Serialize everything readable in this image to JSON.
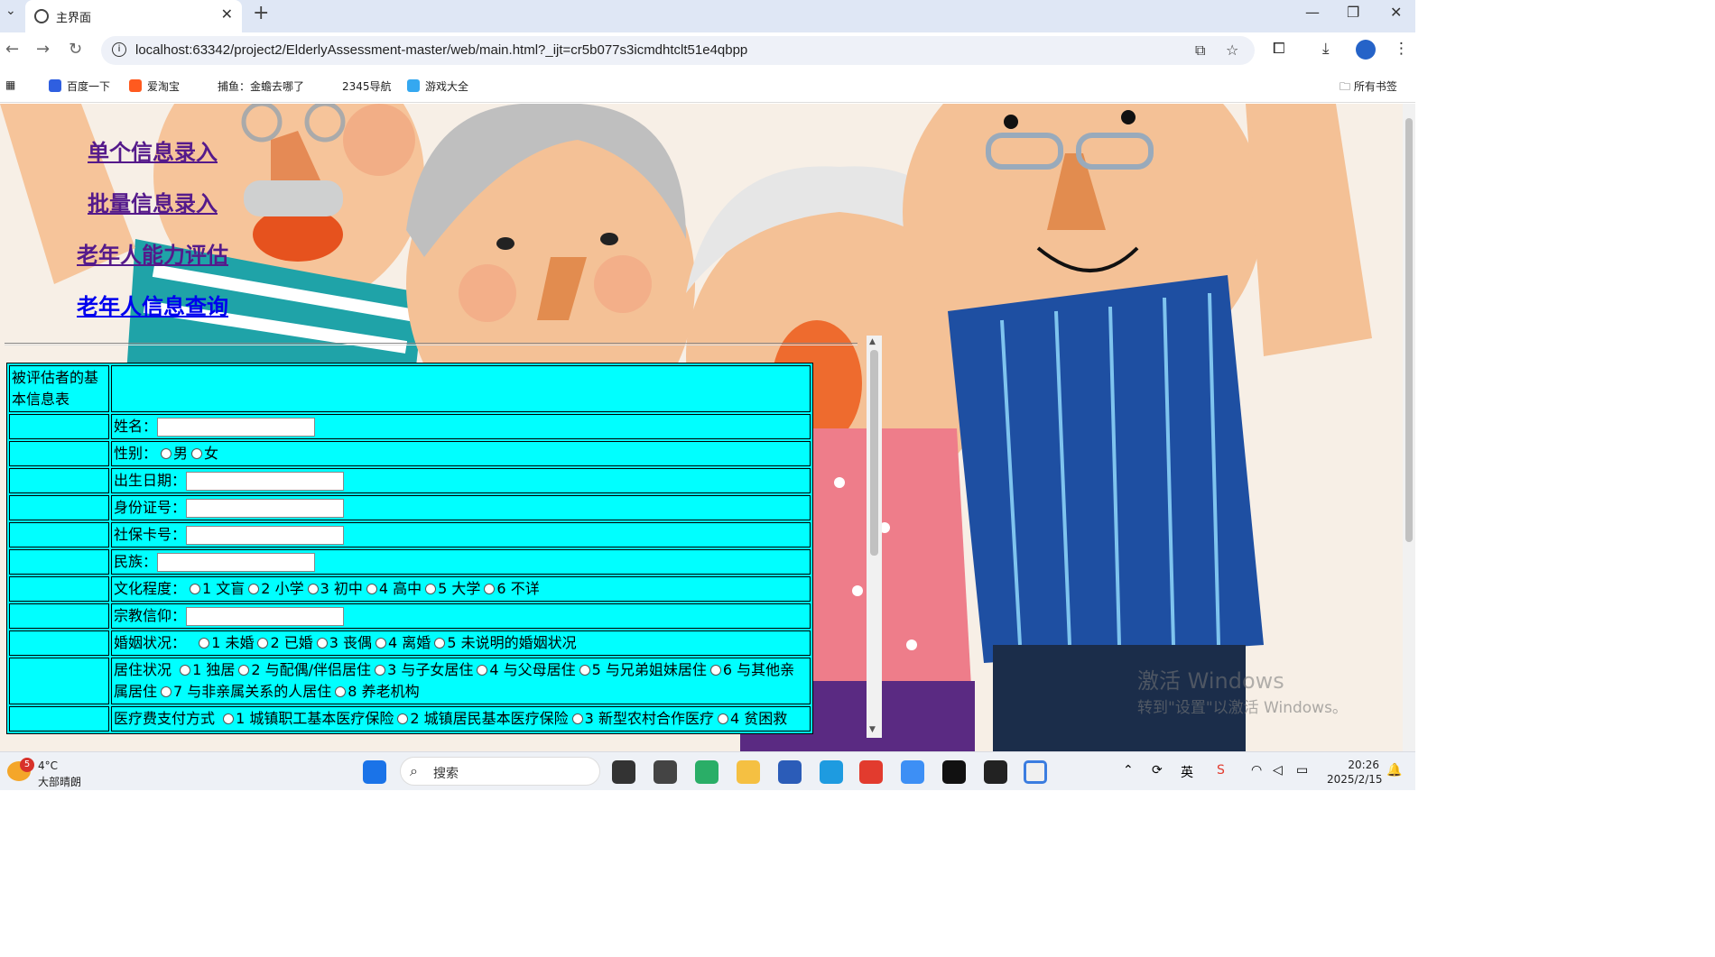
{
  "browser": {
    "tab_title": "主界面",
    "url": "localhost:63342/project2/ElderlyAssessment-master/web/main.html?_ijt=cr5b077s3icmdhtclt51e4qbpp",
    "bookmarks": [
      "百度一下",
      "爱淘宝",
      "捕鱼：金蟾去哪了",
      "2345导航",
      "游戏大全"
    ],
    "all_bookmarks": "所有书签"
  },
  "nav": {
    "single_entry": "单个信息录入",
    "batch_entry": "批量信息录入",
    "ability_assessment": "老年人能力评估",
    "info_query": "老年人信息查询"
  },
  "form": {
    "title": "被评估者的基本信息表",
    "name_label": "姓名：",
    "gender_label": "性别：",
    "gender_options": [
      "男",
      "女"
    ],
    "birth_label": "出生日期：",
    "id_label": "身份证号：",
    "social_label": "社保卡号：",
    "ethnic_label": "民族：",
    "education_label": "文化程度：",
    "education_options": [
      "1 文盲",
      "2 小学",
      "3 初中",
      "4 高中",
      "5 大学",
      "6 不详"
    ],
    "religion_label": "宗教信仰：",
    "marital_label": "婚姻状况：",
    "marital_options": [
      "1 未婚",
      "2 已婚",
      "3 丧偶",
      "4 离婚",
      "5 未说明的婚姻状况"
    ],
    "living_label": "居住状况",
    "living_options": [
      "1 独居",
      "2 与配偶/伴侣居住",
      "3 与子女居住",
      "4 与父母居住",
      "5 与兄弟姐妹居住",
      "6 与其他亲属居住",
      "7 与非亲属关系的人居住",
      "8 养老机构"
    ],
    "payment_label": "医疗费支付方式",
    "payment_options": [
      "1 城镇职工基本医疗保险",
      "2 城镇居民基本医疗保险",
      "3 新型农村合作医疗",
      "4 贫困救"
    ]
  },
  "watermark": {
    "line1": "激活 Windows",
    "line2": "转到\"设置\"以激活 Windows。"
  },
  "taskbar": {
    "weather_temp": "4°C",
    "weather_desc": "大部晴朗",
    "weather_badge": "5",
    "search_label": "搜索",
    "time": "20:26",
    "date": "2025/2/15"
  },
  "colors": {
    "form_bg": "#00ffff",
    "visited_link": "#551a8b",
    "link": "#0000ee"
  }
}
